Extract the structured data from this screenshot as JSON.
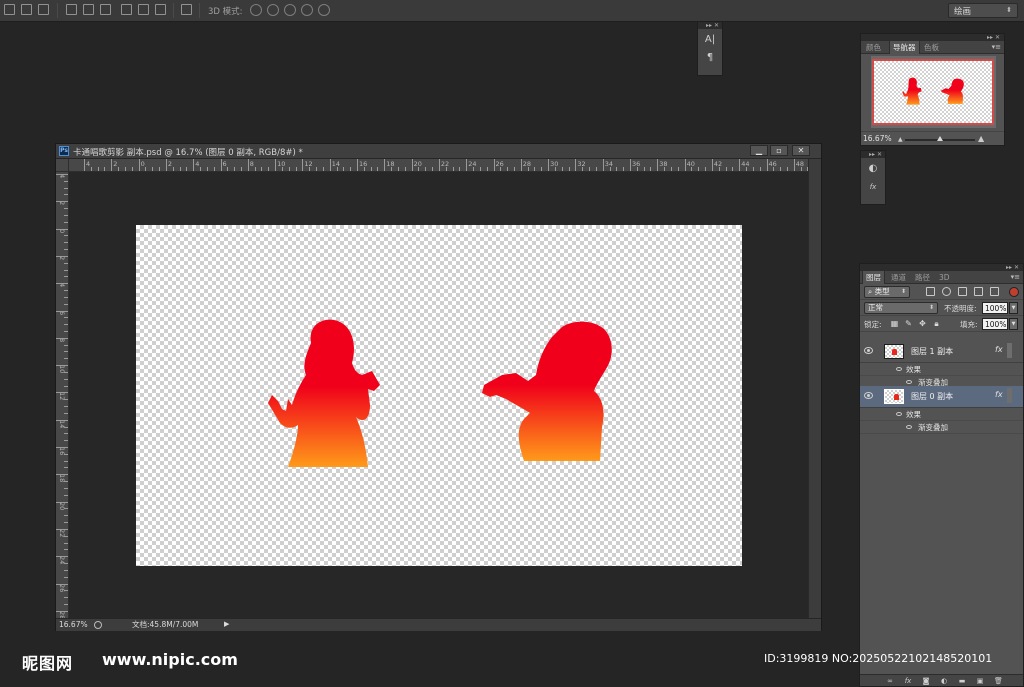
{
  "options_bar": {
    "mode_3d_label": "3D 模式:",
    "workspace_selected": "绘画"
  },
  "document": {
    "title": "卡通唱歌剪影 副本.psd @ 16.7% (图层 0 副本, RGB/8#) *",
    "zoom": "16.67%",
    "doc_info": "文档:45.8M/7.00M",
    "ruler_top_labels": [
      "4",
      "2",
      "0",
      "2",
      "4",
      "6",
      "8",
      "10",
      "12",
      "14",
      "16",
      "18",
      "20",
      "22",
      "24",
      "26",
      "28",
      "30",
      "32",
      "34",
      "36",
      "38",
      "40",
      "42",
      "44",
      "46",
      "48"
    ],
    "ruler_left_labels": [
      "4",
      "2",
      "0",
      "2",
      "4",
      "6",
      "8",
      "10",
      "12",
      "14",
      "16",
      "18",
      "20",
      "22",
      "24",
      "26",
      "28"
    ]
  },
  "char_panel": {
    "tools": [
      "A|",
      "¶"
    ]
  },
  "adjust_panel": {
    "tools": [
      "◐",
      "fx"
    ]
  },
  "navigator": {
    "tabs": [
      "颜色",
      "导航器",
      "色板"
    ],
    "active_tab": "导航器",
    "zoom": "16.67%"
  },
  "layers_panel": {
    "tabs": [
      "图层",
      "通道",
      "路径",
      "3D"
    ],
    "active_tab": "图层",
    "filter_kind": "类型",
    "blend_mode": "正常",
    "opacity_label": "不透明度:",
    "opacity_value": "100%",
    "lock_label": "锁定:",
    "fill_label": "填充:",
    "fill_value": "100%",
    "layers": [
      {
        "name": "图层 1 副本",
        "fx": "fx",
        "effects_label": "效果",
        "effect": "渐变叠加",
        "selected": false
      },
      {
        "name": "图层 0 副本",
        "fx": "fx",
        "effects_label": "效果",
        "effect": "渐变叠加",
        "selected": true
      }
    ]
  },
  "colors": {
    "silhouette_top": "#f0001a",
    "silhouette_bottom": "#ff9a1a",
    "selection_blue": "#5c6a80"
  },
  "watermark": {
    "logo": "昵图网",
    "url": "www.nipic.com",
    "id_text": "ID:3199819 NO:20250522102148520101"
  }
}
